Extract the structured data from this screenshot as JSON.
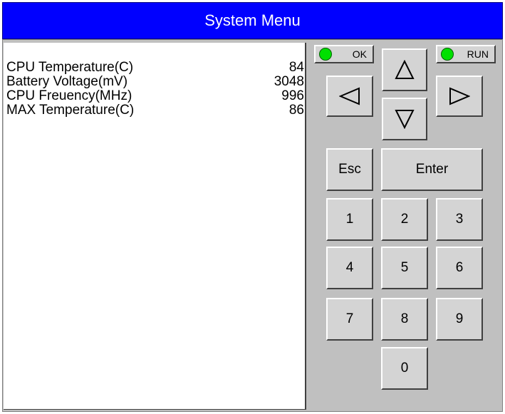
{
  "title": "System Menu",
  "readings": [
    {
      "label": "CPU Temperature(C)",
      "value": "84"
    },
    {
      "label": "Battery Voltage(mV)",
      "value": "3048"
    },
    {
      "label": "CPU Freuency(MHz)",
      "value": "996"
    },
    {
      "label": "MAX Temperature(C)",
      "value": "86"
    }
  ],
  "indicators": {
    "ok_label": "OK",
    "run_label": "RUN",
    "led_color": "#00e000"
  },
  "keypad": {
    "esc": "Esc",
    "enter": "Enter",
    "digits": [
      "0",
      "1",
      "2",
      "3",
      "4",
      "5",
      "6",
      "7",
      "8",
      "9"
    ]
  },
  "colors": {
    "title_bar": "#0000ff",
    "panel": "#c0c0c0"
  }
}
